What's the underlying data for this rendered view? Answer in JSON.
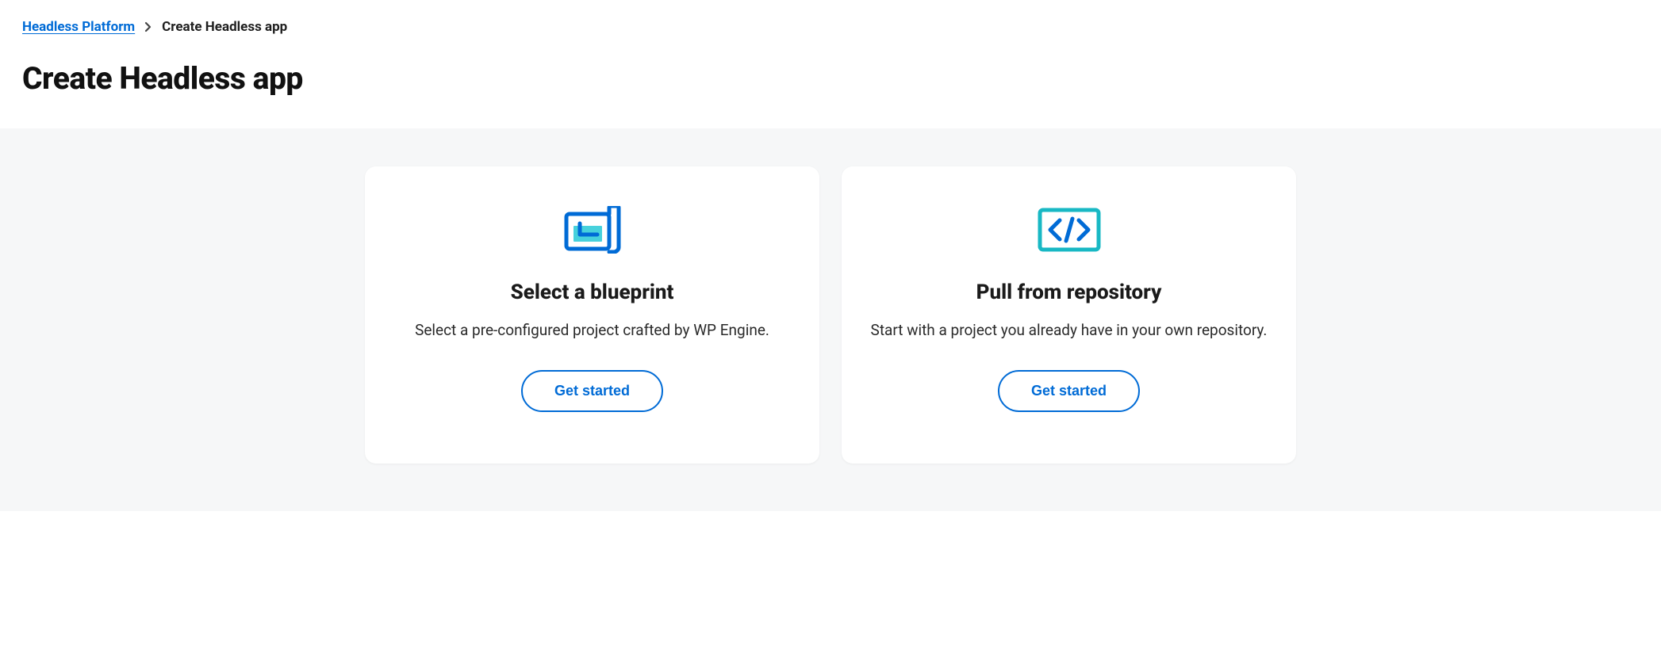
{
  "breadcrumb": {
    "root_label": "Headless Platform",
    "current_label": "Create Headless app"
  },
  "page": {
    "title": "Create Headless app"
  },
  "cards": {
    "blueprint": {
      "title": "Select a blueprint",
      "description": "Select a pre-configured project crafted by WP Engine.",
      "button_label": "Get started"
    },
    "repository": {
      "title": "Pull from repository",
      "description": "Start with a project you already have in your own repository.",
      "button_label": "Get started"
    }
  },
  "colors": {
    "link_blue": "#006bd6",
    "teal": "#18b8c4",
    "bg_gray": "#f6f7f8"
  }
}
